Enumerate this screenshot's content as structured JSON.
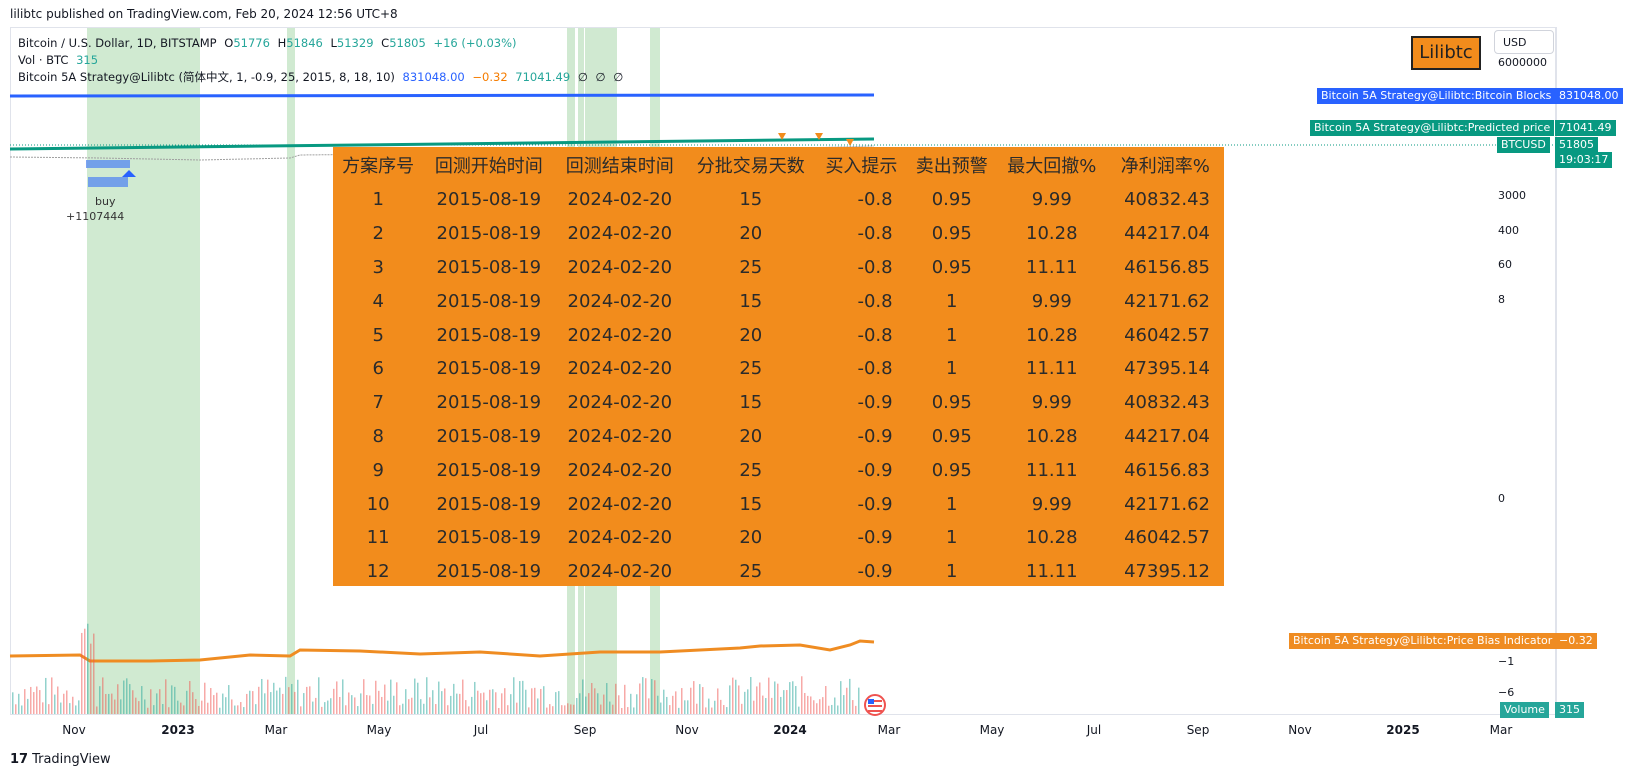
{
  "header": {
    "published": "lilibtc published on TradingView.com, Feb 20, 2024 12:56 UTC+8"
  },
  "legend": {
    "symbol": "Bitcoin / U.S. Dollar, 1D, BITSTAMP",
    "o_label": "O",
    "o_value": "51776",
    "h_label": "H",
    "h_value": "51846",
    "l_label": "L",
    "l_value": "51329",
    "c_label": "C",
    "c_value": "51805",
    "change": "+16 (+0.03%)",
    "vol_label": "Vol · BTC",
    "vol_value": "315",
    "indicator": "Bitcoin 5A Strategy@Lilibtc (简体中文, 1, -0.9, 25, 2015, 8, 18, 10)",
    "ind_v1": "831048.00",
    "ind_v2": "−0.32",
    "ind_v3": "71041.49",
    "ind_v4": "∅",
    "ind_v5": "∅",
    "ind_v6": "∅"
  },
  "toolbar": {
    "currency": "USD",
    "logo_text": "Lilibtc"
  },
  "price_tags": {
    "blocks_label": "Bitcoin 5A Strategy@Lilibtc:Bitcoin Blocks",
    "blocks_value": "831048.00",
    "predicted_label": "Bitcoin 5A Strategy@Lilibtc:Predicted price",
    "predicted_value": "71041.49",
    "btcusd_label": "BTCUSD",
    "btcusd_value": "51805",
    "btcusd_countdown": "19:03:17",
    "bias_label": "Bitcoin 5A Strategy@Lilibtc:Price Bias Indicator",
    "bias_value": "−0.32",
    "volume_label": "Volume",
    "volume_value": "315"
  },
  "price_scale": {
    "values": [
      "6000000",
      "3000",
      "400",
      "60",
      "8",
      "0",
      "−1",
      "−6"
    ]
  },
  "time_axis": {
    "labels": [
      "Nov",
      "2023",
      "Mar",
      "May",
      "Jul",
      "Sep",
      "Nov",
      "2024",
      "Mar",
      "May",
      "Jul",
      "Sep",
      "Nov",
      "2025",
      "Mar"
    ]
  },
  "signals": {
    "buy_label": "buy",
    "buy_value": "+1107444"
  },
  "results_table": {
    "headers": [
      "方案序号",
      "回测开始时间",
      "回测结束时间",
      "分批交易天数",
      "买入提示",
      "卖出预警",
      "最大回撤%",
      "净利润率%"
    ],
    "rows": [
      [
        "1",
        "2015-08-19",
        "2024-02-20",
        "15",
        "-0.8",
        "0.95",
        "9.99",
        "40832.43"
      ],
      [
        "2",
        "2015-08-19",
        "2024-02-20",
        "20",
        "-0.8",
        "0.95",
        "10.28",
        "44217.04"
      ],
      [
        "3",
        "2015-08-19",
        "2024-02-20",
        "25",
        "-0.8",
        "0.95",
        "11.11",
        "46156.85"
      ],
      [
        "4",
        "2015-08-19",
        "2024-02-20",
        "15",
        "-0.8",
        "1",
        "9.99",
        "42171.62"
      ],
      [
        "5",
        "2015-08-19",
        "2024-02-20",
        "20",
        "-0.8",
        "1",
        "10.28",
        "46042.57"
      ],
      [
        "6",
        "2015-08-19",
        "2024-02-20",
        "25",
        "-0.8",
        "1",
        "11.11",
        "47395.14"
      ],
      [
        "7",
        "2015-08-19",
        "2024-02-20",
        "15",
        "-0.9",
        "0.95",
        "9.99",
        "40832.43"
      ],
      [
        "8",
        "2015-08-19",
        "2024-02-20",
        "20",
        "-0.9",
        "0.95",
        "10.28",
        "44217.04"
      ],
      [
        "9",
        "2015-08-19",
        "2024-02-20",
        "25",
        "-0.9",
        "0.95",
        "11.11",
        "46156.83"
      ],
      [
        "10",
        "2015-08-19",
        "2024-02-20",
        "15",
        "-0.9",
        "1",
        "9.99",
        "42171.62"
      ],
      [
        "11",
        "2015-08-19",
        "2024-02-20",
        "20",
        "-0.9",
        "1",
        "10.28",
        "46042.57"
      ],
      [
        "12",
        "2015-08-19",
        "2024-02-20",
        "25",
        "-0.9",
        "1",
        "11.11",
        "47395.12"
      ]
    ]
  },
  "footer": {
    "brand": "TradingView",
    "brand_logo": "17"
  },
  "colors": {
    "blocks_line": "#2962ff",
    "predicted_line": "#089981",
    "bias_line": "#ef8c22",
    "highlight_band": "#c8e6c9",
    "table_bg": "#f28c1c",
    "up": "#26a69a",
    "down": "#ef5350"
  }
}
